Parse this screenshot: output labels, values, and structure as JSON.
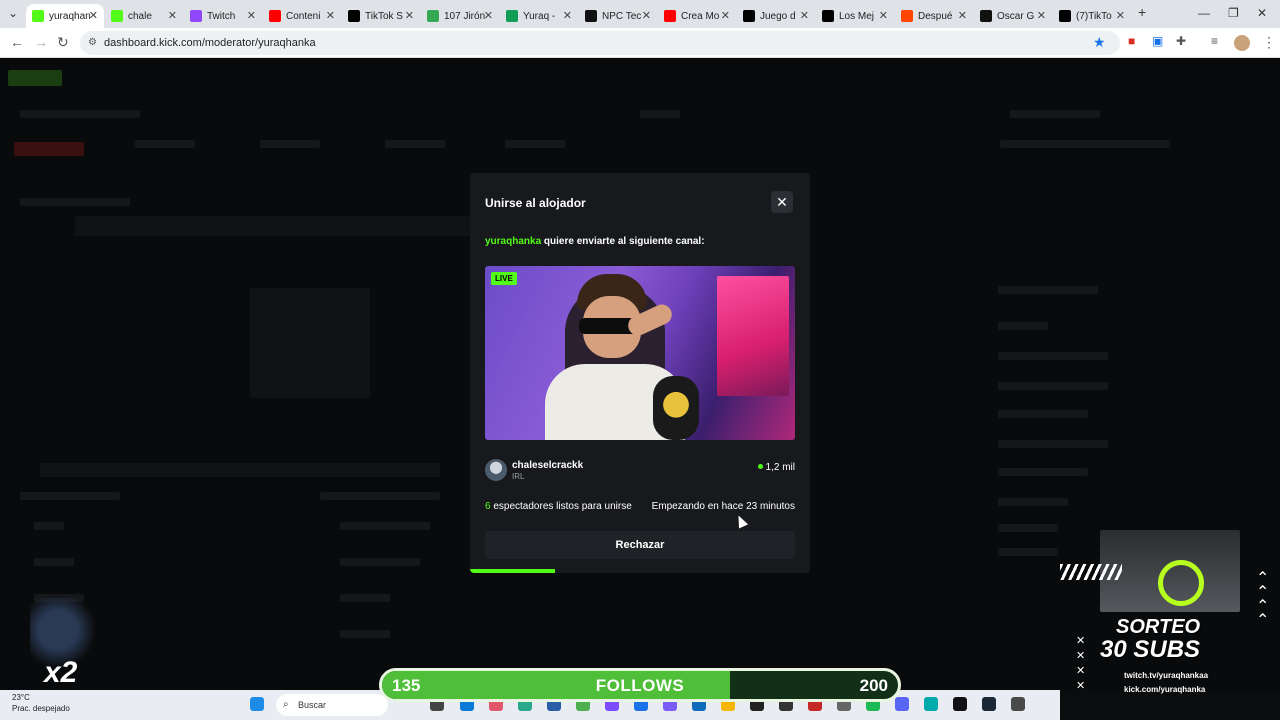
{
  "browser": {
    "tabs": [
      {
        "label": "yuraqhan",
        "active": true,
        "color": "#53fc18"
      },
      {
        "label": "chale",
        "active": false,
        "color": "#53fc18"
      },
      {
        "label": "Twitch",
        "active": false,
        "color": "#9146ff"
      },
      {
        "label": "Conteni",
        "active": false,
        "color": "#ff0000"
      },
      {
        "label": "TikTok S",
        "active": false,
        "color": "#000000"
      },
      {
        "label": "107 Jirón",
        "active": false,
        "color": "#34a853"
      },
      {
        "label": "Yuraq -",
        "active": false,
        "color": "#0f9d58"
      },
      {
        "label": "NPC Tec",
        "active": false,
        "color": "#111111"
      },
      {
        "label": "Crea Mo",
        "active": false,
        "color": "#ff0000"
      },
      {
        "label": "Juego d",
        "active": false,
        "color": "#000000"
      },
      {
        "label": "Los Mej",
        "active": false,
        "color": "#000000"
      },
      {
        "label": "Despué",
        "active": false,
        "color": "#ff4500"
      },
      {
        "label": "Oscar G",
        "active": false,
        "color": "#111111"
      },
      {
        "label": "(7)TikTo",
        "active": false,
        "color": "#000000"
      }
    ],
    "url": "dashboard.kick.com/moderator/yuraqhanka"
  },
  "modal": {
    "title": "Unirse al alojador",
    "host_user": "yuraqhanka",
    "invite_text": " quiere enviarte al siguiente canal:",
    "live_badge": "LIVE",
    "channel_name": "chaleselcrackk",
    "channel_category": "IRL",
    "viewers": "1,2 mil",
    "ready_count": "6",
    "ready_text": " espectadores listos para unirse",
    "starting_text": "Empezando en hace 23 minutos",
    "reject_label": "Rechazar",
    "progress_fraction": 0.25,
    "accent": "#53fc18"
  },
  "overlay": {
    "follows_current": "135",
    "follows_label": "FOLLOWS",
    "follows_goal": "200",
    "follows_fraction": 0.675,
    "sorteo_line1": "SORTEO",
    "sorteo_line2": "30 SUBS",
    "sorteo_twitch": "twitch.tv/yuraqhankaa",
    "sorteo_kick": "kick.com/yuraqhanka",
    "multiplier": "x2"
  },
  "taskbar": {
    "temperature": "23°C",
    "weather": "Prac. despejado",
    "search_placeholder": "Buscar"
  }
}
